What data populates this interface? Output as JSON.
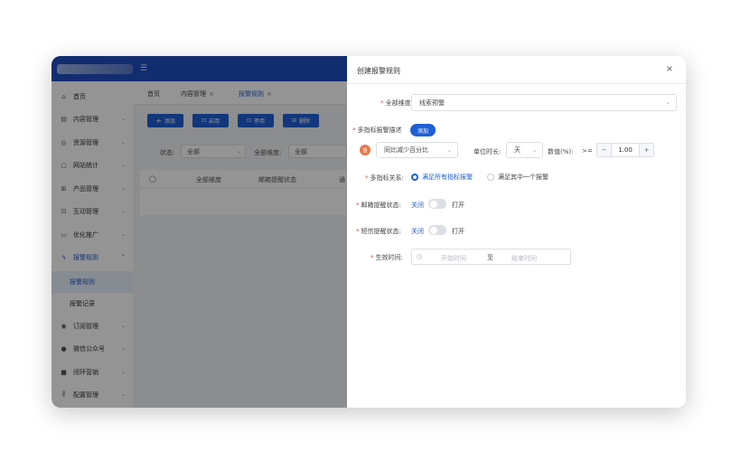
{
  "header": {
    "menu_toggle_icon": "menu-toggle-icon"
  },
  "sidebar": {
    "items": [
      {
        "label": "首页",
        "icon": "home-icon"
      },
      {
        "label": "内容管理",
        "icon": "document-icon"
      },
      {
        "label": "资源管理",
        "icon": "resource-icon"
      },
      {
        "label": "网站统计",
        "icon": "stats-icon"
      },
      {
        "label": "产品管理",
        "icon": "grid-icon"
      },
      {
        "label": "互动管理",
        "icon": "chat-icon"
      },
      {
        "label": "优化推广",
        "icon": "promotion-icon"
      },
      {
        "label": "报警规则",
        "icon": "alarm-icon"
      },
      {
        "label": "订阅管理",
        "icon": "eye-icon"
      },
      {
        "label": "微信公众号",
        "icon": "wechat-icon"
      },
      {
        "label": "闭环营销",
        "icon": "loop-icon"
      },
      {
        "label": "配置管理",
        "icon": "config-icon"
      }
    ],
    "sub_items": [
      {
        "label": "报警规则"
      },
      {
        "label": "报警记录"
      }
    ]
  },
  "tabs": [
    {
      "label": "首页"
    },
    {
      "label": "内容管理",
      "close": "×"
    },
    {
      "label": "报警规则",
      "close": "×"
    }
  ],
  "toolbar": {
    "add": "添加",
    "enable": "启用",
    "disable": "停用",
    "delete": "删除"
  },
  "filters": {
    "status_label": "状态:",
    "status_value": "全部",
    "dimension_label": "全部维度:",
    "dimension_value": "全部"
  },
  "table": {
    "columns": [
      "全部维度",
      "邮箱提醒状态",
      "通"
    ]
  },
  "drawer": {
    "title": "创建报警规则",
    "close": "×",
    "dimension_label": "全部维度:",
    "dimension_value": "线索预警",
    "multi_desc_label": "多指标报警描述",
    "add_button": "添加",
    "delete_badge": "首",
    "metric_value": "同比减少百分比",
    "unit_label": "单位时长:",
    "unit_value": "天",
    "value_label": "数值(%):",
    "operator": ">=",
    "stepper_minus": "−",
    "stepper_value": "1.00",
    "stepper_plus": "+",
    "relation_label": "多指标关系:",
    "relation_options": [
      "满足所有指标报警",
      "满足其中一个报警"
    ],
    "email_label": "邮箱提醒状态:",
    "email_off": "关闭",
    "email_on": "打开",
    "sms_label": "短信提醒状态:",
    "sms_off": "关闭",
    "sms_on": "打开",
    "effective_label": "生效时间:",
    "start_placeholder": "开始时间",
    "range_separator": "至",
    "end_placeholder": "结束时间"
  },
  "colors": {
    "primary": "#1f5fd6",
    "header": "#1f4fbf",
    "danger": "#e8774d"
  }
}
